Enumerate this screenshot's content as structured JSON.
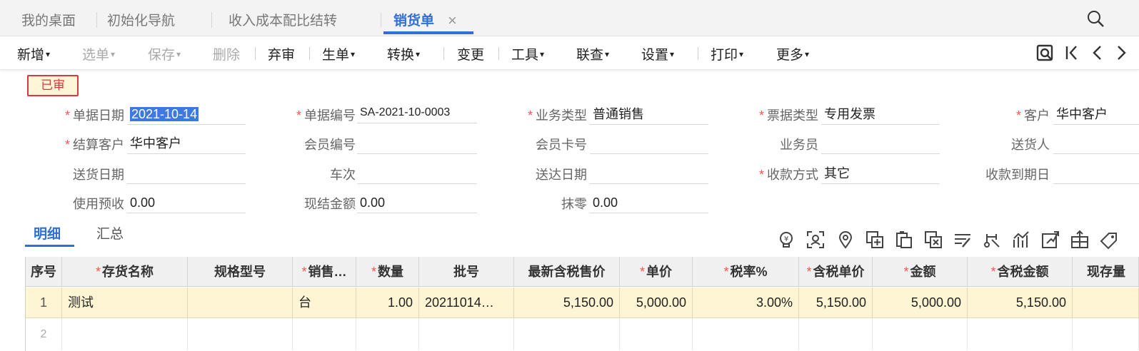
{
  "tabs": [
    {
      "label": "我的桌面"
    },
    {
      "label": "初始化导航"
    },
    {
      "label": "收入成本配比结转"
    },
    {
      "label": "销货单"
    }
  ],
  "tab_close": "×",
  "toolbar": {
    "add": "新增",
    "select": "选单",
    "save": "保存",
    "delete": "删除",
    "abandon": "弃审",
    "generate": "生单",
    "convert": "转换",
    "change": "变更",
    "tools": "工具",
    "link": "联查",
    "settings": "设置",
    "print": "打印",
    "more": "更多"
  },
  "status_badge": "已审",
  "form": {
    "doc_date": {
      "label": "单据日期",
      "value": "2021-10-14"
    },
    "doc_no": {
      "label": "单据编号",
      "value": "SA-2021-10-0003"
    },
    "biz_type": {
      "label": "业务类型",
      "value": "普通销售"
    },
    "invoice_type": {
      "label": "票据类型",
      "value": "专用发票"
    },
    "customer": {
      "label": "客户",
      "value": "华中客户"
    },
    "settle_customer": {
      "label": "结算客户",
      "value": "华中客户"
    },
    "member_no": {
      "label": "会员编号",
      "value": ""
    },
    "card_no": {
      "label": "会员卡号",
      "value": ""
    },
    "salesman": {
      "label": "业务员",
      "value": ""
    },
    "deliverer": {
      "label": "送货人",
      "value": ""
    },
    "delivery_date": {
      "label": "送货日期",
      "value": ""
    },
    "vehicle": {
      "label": "车次",
      "value": ""
    },
    "arrive_date": {
      "label": "送达日期",
      "value": ""
    },
    "pay_method": {
      "label": "收款方式",
      "value": "其它"
    },
    "due_date": {
      "label": "收款到期日",
      "value": ""
    },
    "prepay": {
      "label": "使用预收",
      "value": "0.00"
    },
    "cash_amount": {
      "label": "现结金额",
      "value": "0.00"
    },
    "rounding": {
      "label": "抹零",
      "value": "0.00"
    }
  },
  "subtabs": {
    "detail": "明细",
    "summary": "汇总"
  },
  "grid": {
    "columns": [
      "序号",
      "存货名称",
      "规格型号",
      "销售…",
      "数量",
      "批号",
      "最新含税售价",
      "单价",
      "税率%",
      "含税单价",
      "金额",
      "含税金额",
      "现存量"
    ],
    "rows": [
      [
        "1",
        "测试",
        "",
        "台",
        "1.00",
        "20211014…",
        "5,150.00",
        "5,000.00",
        "3.00%",
        "5,150.00",
        "5,000.00",
        "5,150.00",
        ""
      ],
      [
        "2",
        "",
        "",
        "",
        "",
        "",
        "",
        "",
        "",
        "",
        "",
        "",
        ""
      ]
    ]
  },
  "colors": {
    "accent": "#2f6fd6",
    "required": "#e55555",
    "row_highlight": "#fdf5d3",
    "badge": "#d63b3b"
  }
}
